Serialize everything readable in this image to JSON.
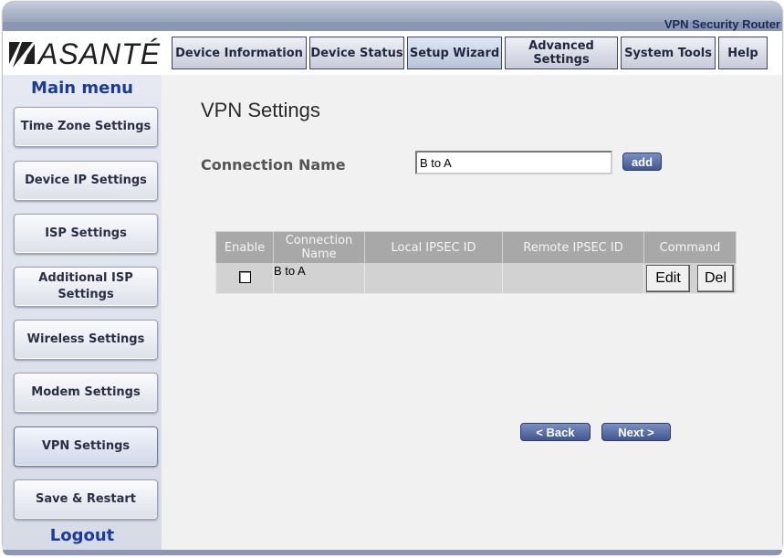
{
  "product": "VPN Security Router",
  "brand": "ASANTÉ",
  "nav_tabs": [
    {
      "label": "Device Information",
      "width": 148
    },
    {
      "label": "Device Status",
      "width": 104
    },
    {
      "label": "Setup Wizard",
      "width": 104
    },
    {
      "label": "Advanced Settings",
      "width": 124
    },
    {
      "label": "System Tools",
      "width": 104
    },
    {
      "label": "Help",
      "width": 54
    }
  ],
  "sidebar": {
    "title": "Main menu",
    "logout": "Logout",
    "items": [
      {
        "label": "Time Zone Settings"
      },
      {
        "label": "Device IP Settings"
      },
      {
        "label": "ISP Settings"
      },
      {
        "label": "Additional ISP Settings"
      },
      {
        "label": "Wireless Settings"
      },
      {
        "label": "Modem Settings"
      },
      {
        "label": "VPN Settings"
      },
      {
        "label": "Save & Restart"
      }
    ]
  },
  "page": {
    "title": "VPN Settings",
    "connection_label": "Connection Name",
    "connection_value": "B to A",
    "add_label": "add",
    "back_label": "< Back",
    "next_label": "Next >"
  },
  "table": {
    "headers": [
      "Enable",
      "Connection Name",
      "Local IPSEC ID",
      "Remote IPSEC ID",
      "Command"
    ],
    "rows": [
      {
        "enabled": false,
        "name": "B to A",
        "local_id": "",
        "remote_id": "",
        "edit": "Edit",
        "del": "Del"
      }
    ]
  },
  "colors": {
    "accent": "#1a3a9c",
    "frame": "#8a96b4"
  }
}
